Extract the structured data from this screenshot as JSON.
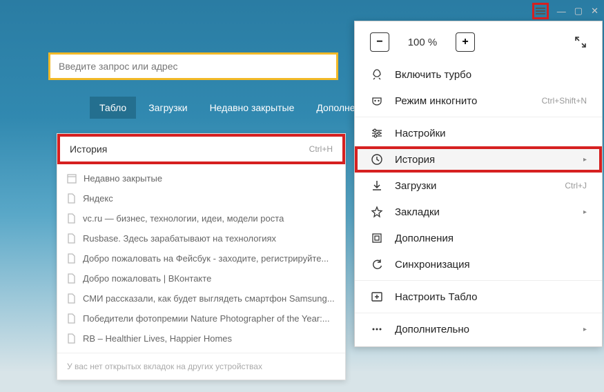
{
  "window": {
    "minimize": "—",
    "maximize": "▢",
    "close": "✕"
  },
  "search": {
    "placeholder": "Введите запрос или адрес"
  },
  "tabs": [
    "Табло",
    "Загрузки",
    "Недавно закрытые",
    "Дополнения"
  ],
  "history_submenu": {
    "title": "История",
    "shortcut": "Ctrl+H",
    "items": [
      "Недавно закрытые",
      "Яндекс",
      "vc.ru — бизнес, технологии, идеи, модели роста",
      "Rusbase. Здесь зарабатывают на технологиях",
      "Добро пожаловать на Фейсбук - заходите, регистрируйте...",
      "Добро пожаловать | ВКонтакте",
      "СМИ рассказали, как будет выглядеть смартфон Samsung...",
      "Победители фотопремии Nature Photographer of the Year:...",
      "RB – Healthier Lives, Happier Homes"
    ],
    "footer": "У вас нет открытых вкладок на других устройствах"
  },
  "menu": {
    "zoom_value": "100 %",
    "turbo": "Включить турбо",
    "incognito": {
      "label": "Режим инкогнито",
      "shortcut": "Ctrl+Shift+N"
    },
    "settings": "Настройки",
    "history": "История",
    "downloads": {
      "label": "Загрузки",
      "shortcut": "Ctrl+J"
    },
    "bookmarks": "Закладки",
    "addons": "Дополнения",
    "sync": "Синхронизация",
    "customize_tablo": "Настроить Табло",
    "more": "Дополнительно"
  }
}
